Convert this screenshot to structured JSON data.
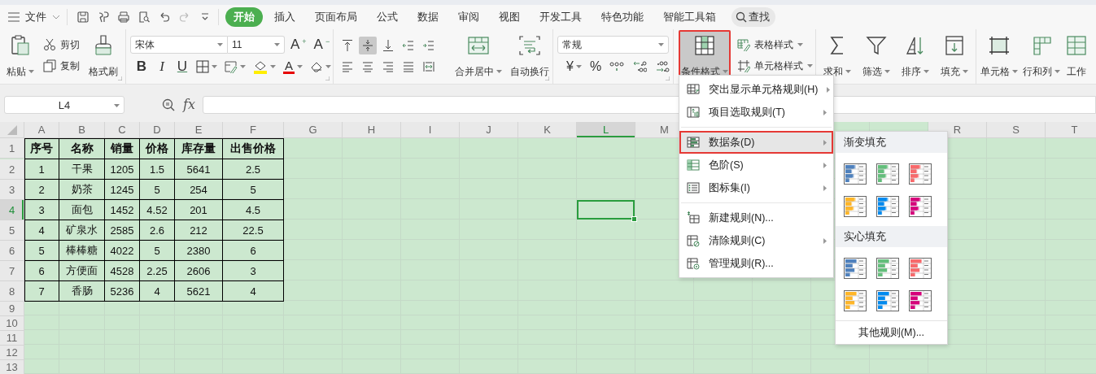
{
  "menu_bar": {
    "file_menu": "文件",
    "tabs": [
      {
        "label": "开始",
        "selected": true
      },
      {
        "label": "插入",
        "selected": false
      },
      {
        "label": "页面布局",
        "selected": false
      },
      {
        "label": "公式",
        "selected": false
      },
      {
        "label": "数据",
        "selected": false
      },
      {
        "label": "审阅",
        "selected": false
      },
      {
        "label": "视图",
        "selected": false
      },
      {
        "label": "开发工具",
        "selected": false
      },
      {
        "label": "特色功能",
        "selected": false
      },
      {
        "label": "智能工具箱",
        "selected": false
      }
    ],
    "search": "查找"
  },
  "ribbon": {
    "groups": [
      {
        "kind": "clipboard",
        "launcher": true,
        "items": [
          {
            "kind": "large",
            "label": "粘贴",
            "dropdown": true,
            "selected": false
          },
          {
            "kind": "stack",
            "items": [
              {
                "label": "剪切"
              },
              {
                "label": "复制"
              }
            ]
          },
          {
            "kind": "large",
            "label": "格式刷",
            "selected": false
          }
        ]
      },
      {
        "kind": "font",
        "launcher": true,
        "font_name": "宋体",
        "font_size": "11",
        "size_buttons": [
          {
            "letter": "A",
            "sign": "+"
          },
          {
            "letter": "A",
            "sign": "−"
          }
        ],
        "style_buttons": [
          "B",
          "I",
          "U"
        ],
        "font_color": {
          "letter": "A",
          "color": "#e60000"
        }
      },
      {
        "kind": "alignment",
        "launcher": true,
        "align_buttons": [
          {
            "selected": false
          },
          {
            "selected": true
          },
          {
            "selected": false
          },
          {
            "selected": false
          },
          {
            "selected": false
          },
          {
            "selected": false
          },
          {
            "selected": false
          },
          {
            "selected": false
          },
          {
            "selected": false
          },
          {
            "selected": false
          }
        ],
        "items": [
          {
            "kind": "large",
            "label": "合并居中",
            "dropdown": true,
            "selected": false
          },
          {
            "kind": "large",
            "label": "自动换行",
            "selected": false
          }
        ]
      },
      {
        "kind": "number",
        "launcher": true,
        "format": "常规",
        "currency": {
          "symbol": "¥",
          "dropdown": true
        },
        "percent": "%"
      },
      {
        "kind": "styles",
        "items": [
          {
            "kind": "large",
            "label": "条件格式",
            "dropdown": true,
            "selected": true,
            "annotated": true
          },
          {
            "kind": "stack",
            "items": [
              {
                "label": "表格样式",
                "dropdown": true
              },
              {
                "label": "单元格样式",
                "dropdown": true
              }
            ]
          }
        ]
      },
      {
        "kind": "editing",
        "items": [
          {
            "kind": "large",
            "label": "求和",
            "dropdown": true,
            "selected": false
          },
          {
            "kind": "large",
            "label": "筛选",
            "dropdown": true,
            "selected": false
          },
          {
            "kind": "large",
            "label": "排序",
            "dropdown": true,
            "selected": false
          },
          {
            "kind": "large",
            "label": "填充",
            "dropdown": true,
            "selected": false
          }
        ]
      },
      {
        "kind": "cells",
        "items": [
          {
            "kind": "large",
            "label": "单元格",
            "dropdown": true,
            "selected": false
          },
          {
            "kind": "large",
            "label": "行和列",
            "dropdown": true,
            "selected": false
          },
          {
            "kind": "large",
            "label": "工作",
            "selected": false
          }
        ]
      }
    ]
  },
  "formula_bar": {
    "name_box": "L4",
    "function_label": "fx"
  },
  "sheet": {
    "columns_left": [
      {
        "label": "A",
        "selected": false
      },
      {
        "label": "B",
        "selected": false
      },
      {
        "label": "C",
        "selected": false
      },
      {
        "label": "D",
        "selected": false
      },
      {
        "label": "E",
        "selected": false
      },
      {
        "label": "F",
        "selected": false
      },
      {
        "label": "G",
        "selected": false
      },
      {
        "label": "H",
        "selected": false
      },
      {
        "label": "I",
        "selected": false
      },
      {
        "label": "J",
        "selected": false
      },
      {
        "label": "K",
        "selected": false
      },
      {
        "label": "L",
        "selected": true
      },
      {
        "label": "M",
        "selected": false
      }
    ],
    "columns_right": [
      {
        "label": "R",
        "selected": false
      },
      {
        "label": "S",
        "selected": false
      },
      {
        "label": "T",
        "selected": false
      }
    ],
    "rows": [
      {
        "header": "1",
        "selected": false,
        "kind": "header",
        "cells": [
          "序号",
          "名称",
          "销量",
          "价格",
          "库存量",
          "出售价格"
        ]
      },
      {
        "header": "2",
        "selected": false,
        "kind": "data",
        "cells": [
          "1",
          "干果",
          "1205",
          "1.5",
          "5641",
          "2.5"
        ]
      },
      {
        "header": "3",
        "selected": false,
        "kind": "data",
        "cells": [
          "2",
          "奶茶",
          "1245",
          "5",
          "254",
          "5"
        ]
      },
      {
        "header": "4",
        "selected": true,
        "kind": "data",
        "cells": [
          "3",
          "面包",
          "1452",
          "4.52",
          "201",
          "4.5"
        ]
      },
      {
        "header": "5",
        "selected": false,
        "kind": "data",
        "cells": [
          "4",
          "矿泉水",
          "2585",
          "2.6",
          "212",
          "22.5"
        ]
      },
      {
        "header": "6",
        "selected": false,
        "kind": "data",
        "cells": [
          "5",
          "棒棒糖",
          "4022",
          "5",
          "2380",
          "6"
        ]
      },
      {
        "header": "7",
        "selected": false,
        "kind": "data",
        "cells": [
          "6",
          "方便面",
          "4528",
          "2.25",
          "2606",
          "3"
        ]
      },
      {
        "header": "8",
        "selected": false,
        "kind": "data",
        "cells": [
          "7",
          "香肠",
          "5236",
          "4",
          "5621",
          "4"
        ]
      },
      {
        "header": "9",
        "selected": false,
        "kind": "empty"
      },
      {
        "header": "10",
        "selected": false,
        "kind": "empty"
      },
      {
        "header": "11",
        "selected": false,
        "kind": "empty"
      },
      {
        "header": "12",
        "selected": false,
        "kind": "empty"
      },
      {
        "header": "13",
        "selected": false,
        "kind": "empty"
      }
    ]
  },
  "conditional_format_menu": {
    "items": [
      {
        "kind": "item",
        "label": "突出显示单元格规则(H)",
        "submenu": true,
        "selected": false,
        "annotated": false
      },
      {
        "kind": "item",
        "label": "项目选取规则(T)",
        "submenu": true,
        "selected": false,
        "annotated": false
      },
      {
        "kind": "separator"
      },
      {
        "kind": "item",
        "label": "数据条(D)",
        "submenu": true,
        "selected": true,
        "annotated": true
      },
      {
        "kind": "item",
        "label": "色阶(S)",
        "submenu": true,
        "selected": false,
        "annotated": false
      },
      {
        "kind": "item",
        "label": "图标集(I)",
        "submenu": true,
        "selected": false,
        "annotated": false
      },
      {
        "kind": "separator"
      },
      {
        "kind": "item",
        "label": "新建规则(N)...",
        "submenu": false,
        "selected": false,
        "annotated": false
      },
      {
        "kind": "item",
        "label": "清除规则(C)",
        "submenu": true,
        "selected": false,
        "annotated": false
      },
      {
        "kind": "item",
        "label": "管理规则(R)...",
        "submenu": false,
        "selected": false,
        "annotated": false
      }
    ]
  },
  "data_bar_submenu": {
    "sections": [
      {
        "title": "渐变填充",
        "kind": "gradient",
        "swatches": [
          {
            "color": "#4f81bd"
          },
          {
            "color": "#63be7b"
          },
          {
            "color": "#f8696b"
          },
          {
            "color": "#ffb628"
          },
          {
            "color": "#008aef"
          },
          {
            "color": "#d6007b"
          }
        ]
      },
      {
        "title": "实心填充",
        "kind": "solid",
        "swatches": [
          {
            "color": "#4f81bd"
          },
          {
            "color": "#63be7b"
          },
          {
            "color": "#f8696b"
          },
          {
            "color": "#ffb628"
          },
          {
            "color": "#008aef"
          },
          {
            "color": "#d6007b"
          }
        ]
      }
    ],
    "footer": "其他规则(M)..."
  }
}
